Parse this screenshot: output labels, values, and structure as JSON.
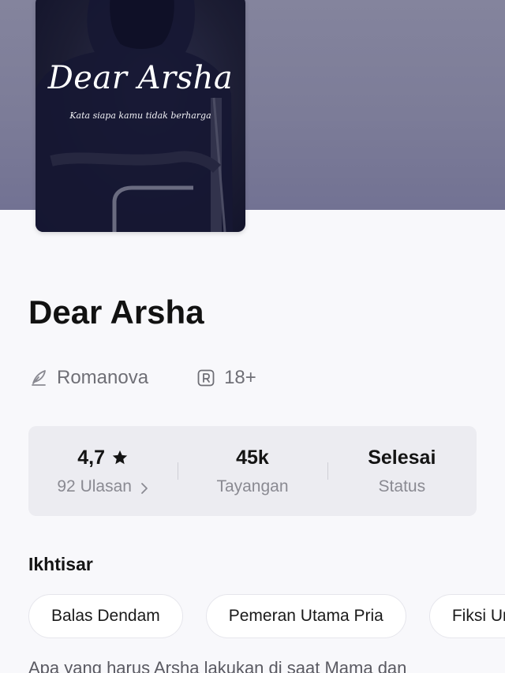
{
  "cover": {
    "title": "Dear Arsha",
    "subtitle": "Kata siapa kamu tidak berharga"
  },
  "book": {
    "title": "Dear Arsha",
    "author": "Romanova",
    "rating_badge": "18+"
  },
  "stats": {
    "rating": "4,7",
    "reviews": "92 Ulasan",
    "views": "45k",
    "views_label": "Tayangan",
    "status": "Selesai",
    "status_label": "Status"
  },
  "overview": {
    "title": "Ikhtisar",
    "tags": [
      "Balas Dendam",
      "Pemeran Utama Pria",
      "Fiksi Ur"
    ],
    "synopsis": "Apa yang harus Arsha lakukan di saat Mama dan"
  },
  "icons": {
    "author": "quill-icon",
    "rating": "r-badge-icon",
    "star": "star-icon",
    "chevron": "chevron-right-icon"
  },
  "colors": {
    "banner": "#7c7c98",
    "card": "#ececf1",
    "background": "#f8f8fb"
  }
}
